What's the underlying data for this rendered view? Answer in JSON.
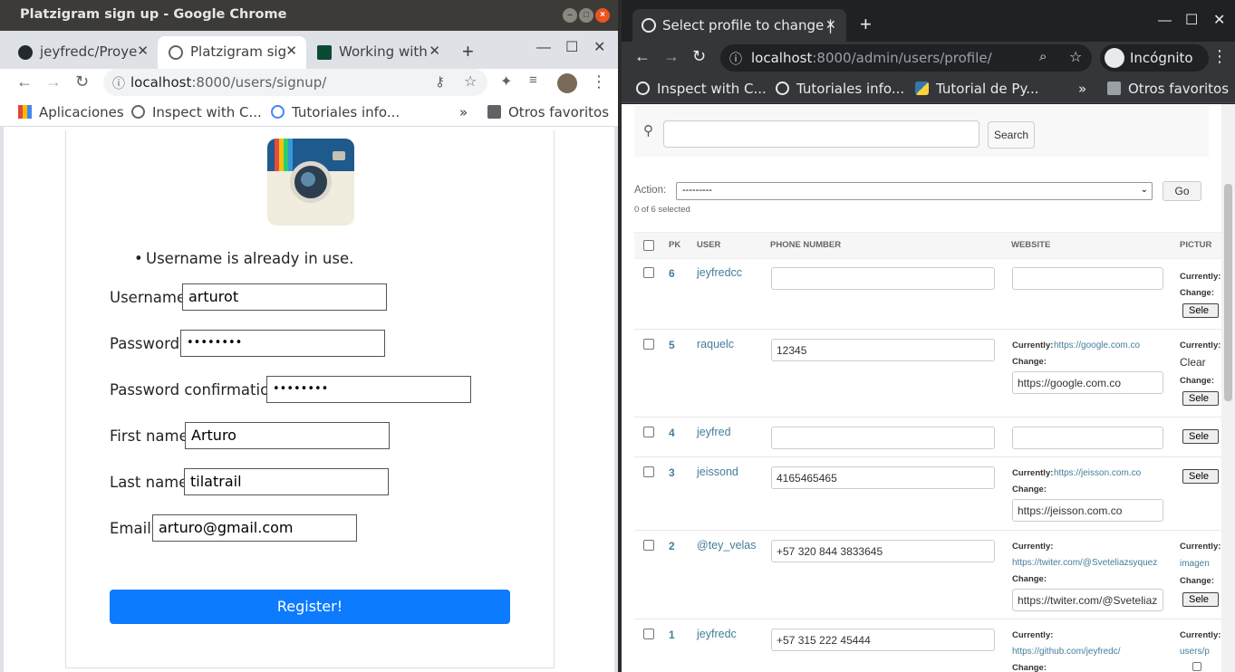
{
  "left_window": {
    "title": "Platzigram sign up - Google Chrome",
    "tabs": [
      {
        "label": "jeyfredc/Proye",
        "fav_color": "#24292e"
      },
      {
        "label": "Platzigram sig",
        "fav_color": "#5f6368"
      },
      {
        "label": "Working with",
        "fav_color": "#0c4b33"
      }
    ],
    "url_host": "localhost",
    "url_rest": ":8000/users/signup/",
    "bookmarks": [
      "Aplicaciones",
      "Inspect with C...",
      "Tutoriales info...",
      "Otros favoritos"
    ],
    "more": "»",
    "form": {
      "error": "Username is already in use.",
      "username_label": "Username:",
      "username_value": "arturot",
      "password_label": "Password:",
      "password_value": "••••••••",
      "password_confirmation_label": "Password confirmation:",
      "password_confirmation_value": "••••••••",
      "first_name_label": "First name:",
      "first_name_value": "Arturo",
      "last_name_label": "Last name:",
      "last_name_value": "tilatrail",
      "email_label": "Email:",
      "email_value": "arturo@gmail.com",
      "register_label": "Register!"
    }
  },
  "right_window": {
    "tab_label": "Select profile to change |",
    "url_host": "localhost",
    "url_rest": ":8000/admin/users/profile/",
    "incognito_label": "Incógnito",
    "bookmarks": [
      "Inspect with C...",
      "Tutoriales info...",
      "Tutorial de Py...",
      "Otros favoritos"
    ],
    "more": "»",
    "search_button": "Search",
    "action_label": "Action:",
    "action_value": "---------",
    "go_button": "Go",
    "selected_count": "0 of 6 selected",
    "headers": [
      "PK",
      "USER",
      "PHONE NUMBER",
      "WEBSITE",
      "PICTUR"
    ],
    "rows": [
      {
        "pk": "6",
        "user": "jeyfredcc",
        "phone": "",
        "website_currently": "",
        "website_change": "",
        "picture": "Currently:|Change:|Sele"
      },
      {
        "pk": "5",
        "user": "raquelc",
        "phone": "12345",
        "website_currently": "https://google.com.co",
        "website_change": "https://google.com.co",
        "picture": "Currently:|Clear|Change:|Sele"
      },
      {
        "pk": "4",
        "user": "jeyfred",
        "phone": "",
        "website_currently": "",
        "website_change": "",
        "picture": "Sele"
      },
      {
        "pk": "3",
        "user": "jeissond",
        "phone": "4165465465",
        "website_currently": "https://jeisson.com.co",
        "website_change": "https://jeisson.com.co",
        "picture": "Sele"
      },
      {
        "pk": "2",
        "user": "@tey_velas",
        "phone": "+57 320 844 3833645",
        "website_currently": "https://twiter.com/@Sveteliazsyquez",
        "website_change": "https://twiter.com/@Sveteliaz",
        "picture": "Currently:|imagen|Change:|Sele"
      },
      {
        "pk": "1",
        "user": "jeyfredc",
        "phone": "+57 315 222 45444",
        "website_currently": "https://github.com/jeyfredc/",
        "website_change": "",
        "picture": "Currently:|users/p"
      }
    ],
    "labels": {
      "currently": "Currently:",
      "change": "Change:",
      "clear": "Clear",
      "select": "Sele",
      "imagen": "imagen",
      "users_p": "users/p"
    }
  }
}
